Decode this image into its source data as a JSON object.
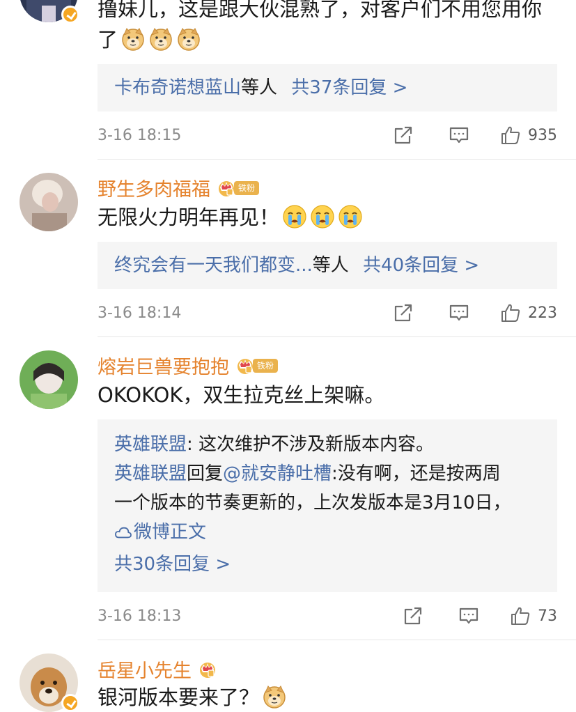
{
  "comments": [
    {
      "id": "c0",
      "text_lines": [
        "撸妹儿，这是跟大伙混熟了，对客户们不用您用你",
        "了"
      ],
      "emoji": [
        "doge",
        "doge",
        "doge"
      ],
      "reply_summary": {
        "names": "卡布奇诺想蓝山",
        "suffix": "等人",
        "count_label": "共37条回复 >"
      },
      "time": "3-16 18:15",
      "likes": "935"
    },
    {
      "id": "c1",
      "username": "野生多肉福福",
      "badge_tag": "铁粉",
      "text": "无限火力明年再见！",
      "emoji": [
        "cry",
        "cry",
        "cry"
      ],
      "reply_summary": {
        "names": "终究会有一天我们都变...",
        "suffix": "等人",
        "count_label": "共40条回复 >"
      },
      "time": "3-16 18:14",
      "likes": "223"
    },
    {
      "id": "c2",
      "username": "熔岩巨兽要抱抱",
      "badge_tag": "铁粉",
      "text": "OKOKOK，双生拉克丝上架嘛。",
      "replies": [
        {
          "author": "英雄联盟",
          "text": ": 这次维护不涉及新版本内容。"
        },
        {
          "author": "英雄联盟",
          "reply_word": "回复",
          "mention": "@就安静吐槽",
          "text": ":没有啊，还是按两周",
          "text2": "一个版本的节奏更新的，上次发版本是3月10日，",
          "source": "微博正文"
        }
      ],
      "count_label": "共30条回复 >",
      "time": "3-16 18:13",
      "likes": "73"
    },
    {
      "id": "c3",
      "username": "岳星小先生",
      "text": "银河版本要来了？",
      "emoji": [
        "doge"
      ]
    }
  ],
  "icons": {
    "share": "share-icon",
    "comment": "comment-icon",
    "like": "thumbs-up-icon",
    "crown": "crown-badge-icon",
    "verified": "verified-badge-icon",
    "weibo": "weibo-cloud-icon"
  },
  "colors": {
    "username": "#e5832e",
    "link": "#4a6ea9",
    "reply_bg": "#f5f5f5",
    "meta": "#8a8a8a",
    "badge": "#eab24d",
    "verified": "#f5a623"
  }
}
